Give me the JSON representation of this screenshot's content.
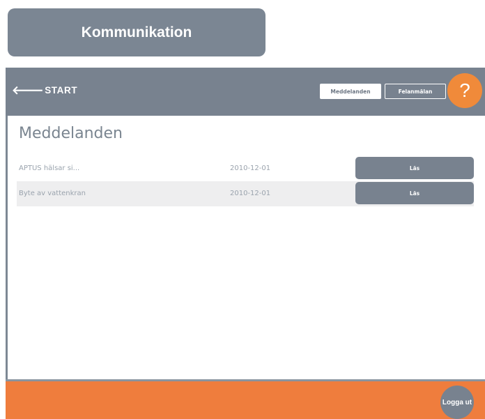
{
  "page_title": "Kommunikation",
  "topbar": {
    "back_arrow": "🡐",
    "back_label": "START",
    "tabs": [
      {
        "label": "Meddelanden",
        "active": true
      },
      {
        "label": "Felanmälan",
        "active": false
      }
    ],
    "help_label": "?"
  },
  "main": {
    "heading": "Meddelanden",
    "messages": [
      {
        "subject": "APTUS hälsar si...",
        "date": "2010-12-01",
        "action": "Läs"
      },
      {
        "subject": "Byte av vattenkran",
        "date": "2010-12-01",
        "action": "Läs"
      }
    ]
  },
  "footer": {
    "logout_label": "Logga ut"
  },
  "colors": {
    "bar": "#78828f",
    "accent": "#ef7d3d",
    "row_alt": "#eeeeef"
  }
}
